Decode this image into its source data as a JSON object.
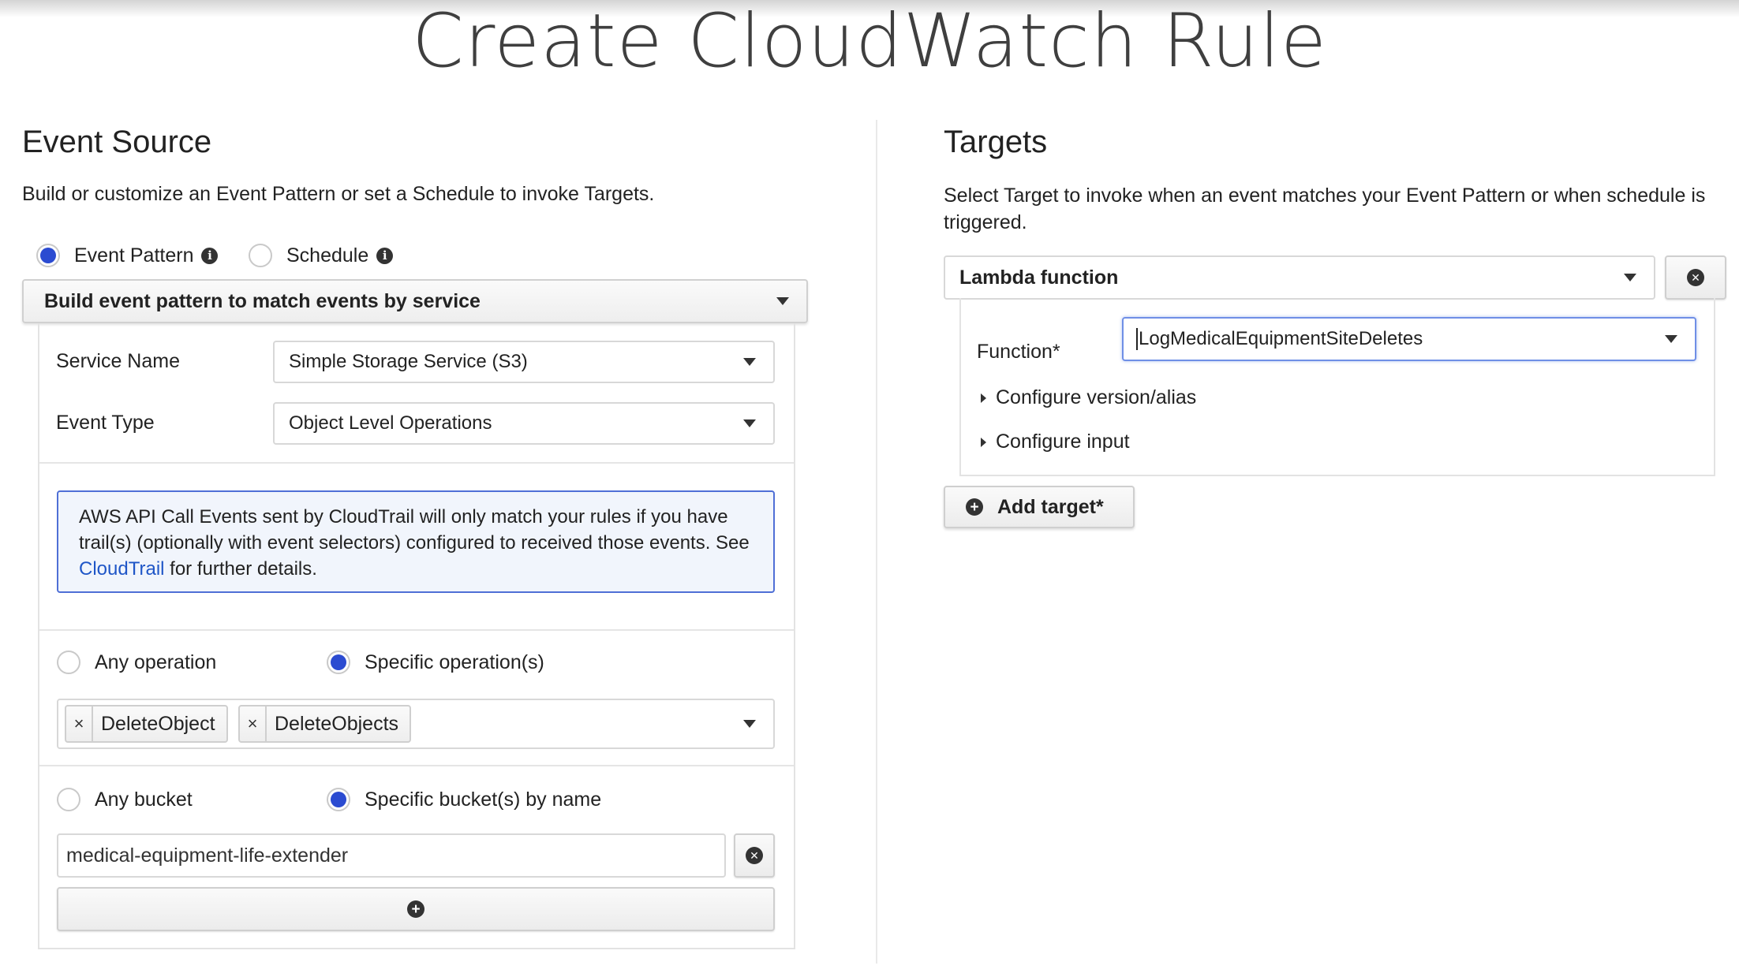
{
  "page": {
    "title": "Create CloudWatch Rule"
  },
  "event_source": {
    "title": "Event Source",
    "description": "Build or customize an Event Pattern or set a Schedule to invoke Targets.",
    "mode_options": [
      {
        "label": "Event Pattern",
        "checked": true
      },
      {
        "label": "Schedule",
        "checked": false
      }
    ],
    "pattern_mode": "Build event pattern to match events by service",
    "service_name_label": "Service Name",
    "service_name_value": "Simple Storage Service (S3)",
    "event_type_label": "Event Type",
    "event_type_value": "Object Level Operations",
    "notice": {
      "text_before": "AWS API Call Events sent by CloudTrail will only match your rules if you have trail(s) (optionally with event selectors) configured to received those events. See ",
      "link": "CloudTrail",
      "text_after": " for further details."
    },
    "operation_options": [
      {
        "label": "Any operation",
        "checked": false
      },
      {
        "label": "Specific operation(s)",
        "checked": true
      }
    ],
    "operation_tags": [
      "DeleteObject",
      "DeleteObjects"
    ],
    "bucket_options": [
      {
        "label": "Any bucket",
        "checked": false
      },
      {
        "label": "Specific bucket(s) by name",
        "checked": true
      }
    ],
    "bucket_value": "medical-equipment-life-extender"
  },
  "targets": {
    "title": "Targets",
    "description": "Select Target to invoke when an event matches your Event Pattern or when schedule is triggered.",
    "target_type": "Lambda function",
    "function_label": "Function*",
    "function_value": "LogMedicalEquipmentSiteDeletes",
    "configure_version": "Configure version/alias",
    "configure_input": "Configure input",
    "add_target_label": "Add target*"
  },
  "icons": {
    "info": "info-icon",
    "remove": "remove-circle-icon",
    "add": "add-circle-icon",
    "dropdown": "chevron-down-icon"
  },
  "colors": {
    "radio_selected": "#2b4bd1",
    "notice_border": "#4f6fd6",
    "notice_bg": "#f1f5fc",
    "link": "#1f56c7",
    "focus_border": "#6f8fe6"
  }
}
